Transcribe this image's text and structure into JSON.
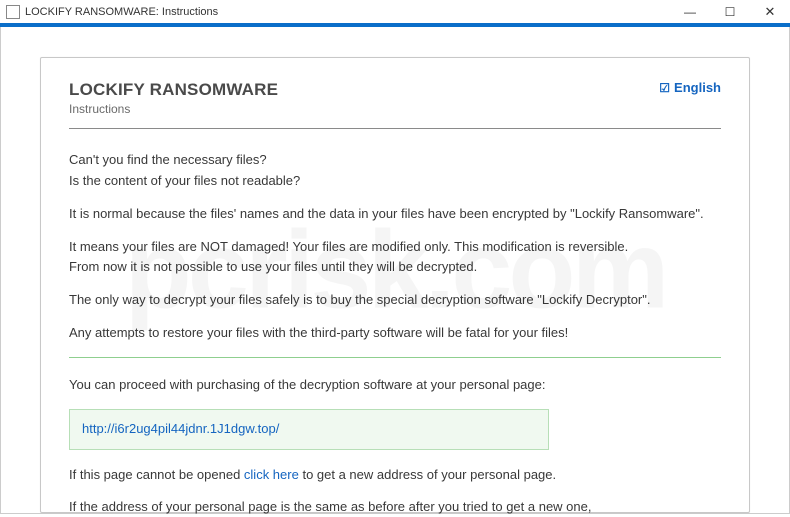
{
  "titlebar": {
    "title": "LOCKIFY RANSOMWARE: Instructions"
  },
  "lang": {
    "label": "English"
  },
  "doc": {
    "title": "LOCKIFY RANSOMWARE",
    "subtitle": "Instructions"
  },
  "content": {
    "q1": "Can't you find the necessary files?",
    "q2": "Is the content of your files not readable?",
    "p1": "It is normal because the files' names and the data in your files have been encrypted by \"Lockify Ransomware\".",
    "p2a": "It means your files are NOT damaged! Your files are modified only. This modification is reversible.",
    "p2b": "From now it is not possible to use your files until they will be decrypted.",
    "p3": "The only way to decrypt your files safely is to buy the special decryption software \"Lockify Decryptor\".",
    "p4": "Any attempts to restore your files with the third-party software will be fatal for your files!",
    "p5": "You can proceed with purchasing of the decryption software at your personal page:",
    "url": "http://i6r2ug4pil44jdnr.1J1dgw.top/",
    "p6a": "If this page cannot be opened ",
    "p6link": " click here ",
    "p6b": " to get a new address of your personal page.",
    "p7": "If the address of your personal page is the same as before after you tried to get a new one,"
  }
}
